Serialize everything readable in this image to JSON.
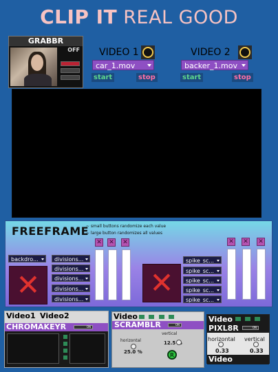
{
  "title": {
    "bold": "CLIP IT",
    "rest": " REAL GOOD"
  },
  "grabber": {
    "label": "GRABBR",
    "power": "OFF"
  },
  "video1": {
    "label": "VIDEO 1",
    "file": "car_1.mov",
    "start": "start",
    "stop": "stop"
  },
  "video2": {
    "label": "VIDEO 2",
    "file": "backer_1.mov",
    "start": "start",
    "stop": "stop"
  },
  "freeframe": {
    "title": "FREEFRAME",
    "note1": "~ small buttons randomize each value",
    "note2": "~ large button randomizes all values",
    "left_menu_top": "backdro...",
    "left_menus": [
      "divisions...",
      "divisions...",
      "divisions...",
      "divisions...",
      "divisions..."
    ],
    "right_menus": [
      "spike_sc...",
      "spike_sc...",
      "spike_sc...",
      "spike_sc...",
      "spike_sc..."
    ],
    "x_glyph": "✕"
  },
  "chromakeyr": {
    "head_left": "Video1",
    "head_right": "Video2",
    "title": "CHROMAKEYR",
    "toggle": "ON"
  },
  "scramblr": {
    "head": "Video",
    "title": "SCRAMBLR",
    "toggle": "ON",
    "horizontal_label": "horizontal",
    "horizontal_value": "25.0 %",
    "vertical_label": "vertical",
    "vertical_value": "12.5 %",
    "randomize": "R"
  },
  "pixl8r": {
    "head": "Video",
    "title": "PIXL8R",
    "toggle": "ON",
    "horizontal_label": "horizontal",
    "horizontal_value": "0.33",
    "vertical_label": "vertical",
    "vertical_value": "0.33",
    "footer": "Video"
  }
}
